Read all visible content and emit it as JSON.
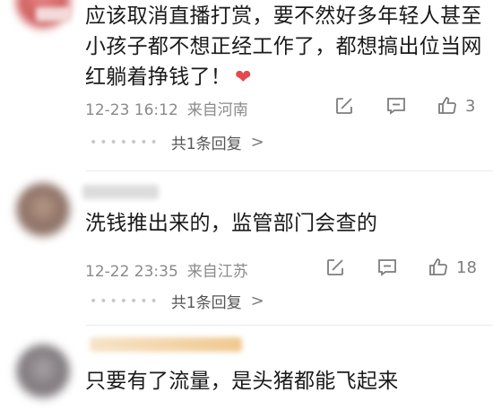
{
  "comments": [
    {
      "text": "应该取消直播打赏，要不然好多年轻人甚至小孩子都不想正经工作了，都想搞出位当网红躺着挣钱了！",
      "emoji": "❤",
      "time": "12-23 16:12",
      "location": "来自河南",
      "likes": "3",
      "replies": "共1条回复",
      "dots": "•••••••",
      "chevron": ">"
    },
    {
      "text": "洗钱推出来的，监管部门会查的",
      "time": "12-22 23:35",
      "location": "来自江苏",
      "likes": "18",
      "replies": "共1条回复",
      "dots": "•••••••",
      "chevron": ">"
    },
    {
      "text": "只要有了流量，是头猪都能飞起来"
    }
  ],
  "colors": {
    "heart": "#e5484d",
    "meta_gray": "#8a8a8a"
  },
  "icons": [
    "share-icon",
    "comment-icon",
    "like-icon"
  ]
}
